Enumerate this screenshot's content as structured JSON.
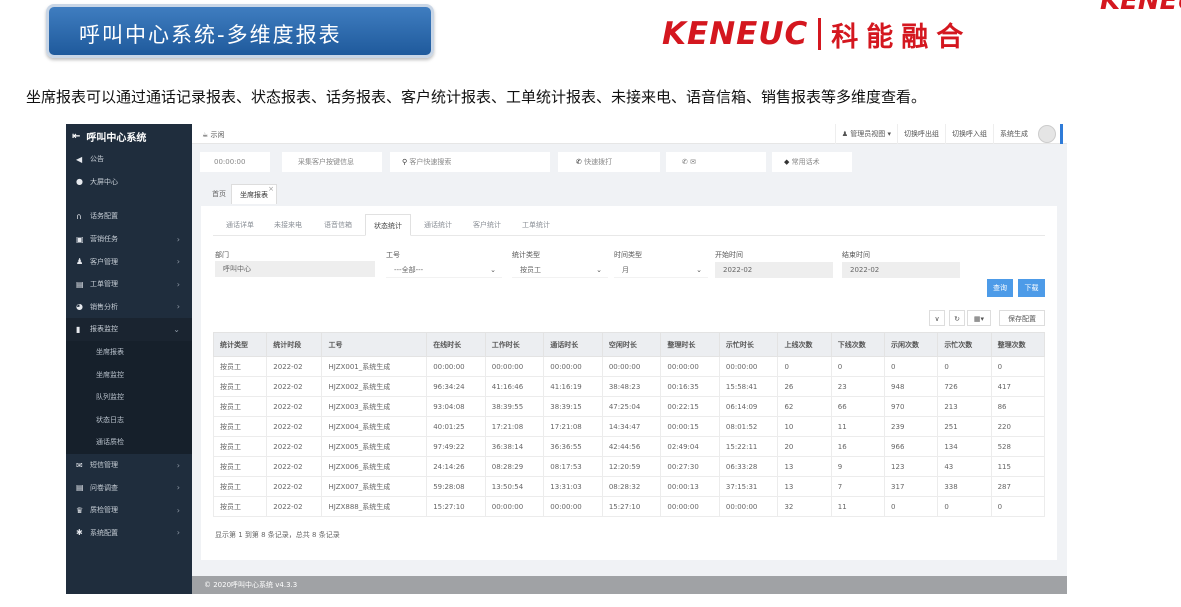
{
  "slide": {
    "banner_title": "呼叫中心系统-多维度报表",
    "logo_en": "KENEUC",
    "logo_cn": "科能融合",
    "logo_corner": "KENEUC",
    "description": "坐席报表可以通过通话记录报表、状态报表、话务报表、客户统计报表、工单统计报表、未接来电、语音信箱、销售报表等多维度查看。",
    "brand_color": "#d4171f"
  },
  "sidebar": {
    "title": "呼叫中心系统",
    "items": [
      {
        "label": "公告",
        "icon": "speaker-icon"
      },
      {
        "label": "大屏中心",
        "icon": "monitor-icon"
      },
      {
        "label": "话务配置",
        "icon": "headset-icon"
      },
      {
        "label": "营销任务",
        "icon": "briefcase-icon"
      },
      {
        "label": "客户管理",
        "icon": "user-icon"
      },
      {
        "label": "工单管理",
        "icon": "document-icon"
      },
      {
        "label": "销售分析",
        "icon": "pie-chart-icon"
      },
      {
        "label": "报表监控",
        "icon": "bar-chart-icon"
      }
    ],
    "report_sub": [
      "坐席报表",
      "坐席监控",
      "队列监控",
      "状态日志",
      "通话质检"
    ],
    "items_after": [
      {
        "label": "短信管理",
        "icon": "envelope-icon"
      },
      {
        "label": "问卷调查",
        "icon": "document-icon"
      },
      {
        "label": "质检管理",
        "icon": "trophy-icon"
      },
      {
        "label": "系统配置",
        "icon": "cog-icon"
      }
    ]
  },
  "topbar": {
    "status": "示闲",
    "admin_view": "管理员视图",
    "switch_out": "切换呼出组",
    "switch_in": "切换呼入组",
    "user": "系统生成"
  },
  "searchbar": {
    "timer": "00:00:00",
    "collect_info": "采集客户按键信息",
    "customer_search": "客户快速搜索",
    "quick_dial": "快速拨打",
    "common_scripts": "常用话术"
  },
  "page_tabs": {
    "home": "首页",
    "active": "坐席报表"
  },
  "subtabs": [
    "通话详单",
    "未接来电",
    "语音信箱",
    "状态统计",
    "通话统计",
    "客户统计",
    "工单统计"
  ],
  "filters": {
    "dept_label": "部门",
    "dept_value": "呼叫中心",
    "worknum_label": "工号",
    "worknum_value": "---全部---",
    "stat_type_label": "统计类型",
    "stat_type_value": "按员工",
    "time_type_label": "时间类型",
    "time_type_value": "月",
    "start_label": "开始时间",
    "start_value": "2022-02",
    "end_label": "结束时间",
    "end_value": "2022-02",
    "query_btn": "查询",
    "download_btn": "下载",
    "save_cfg": "保存配置"
  },
  "table": {
    "headers": [
      "统计类型",
      "统计时段",
      "工号",
      "在线时长",
      "工作时长",
      "通话时长",
      "空闲时长",
      "整理时长",
      "示忙时长",
      "上线次数",
      "下线次数",
      "示闲次数",
      "示忙次数",
      "整理次数"
    ],
    "rows": [
      [
        "按员工",
        "2022-02",
        "HJZX001_系统生成",
        "00:00:00",
        "00:00:00",
        "00:00:00",
        "00:00:00",
        "00:00:00",
        "00:00:00",
        "0",
        "0",
        "0",
        "0",
        "0"
      ],
      [
        "按员工",
        "2022-02",
        "HJZX002_系统生成",
        "96:34:24",
        "41:16:46",
        "41:16:19",
        "38:48:23",
        "00:16:35",
        "15:58:41",
        "26",
        "23",
        "948",
        "726",
        "417"
      ],
      [
        "按员工",
        "2022-02",
        "HJZX003_系统生成",
        "93:04:08",
        "38:39:55",
        "38:39:15",
        "47:25:04",
        "00:22:15",
        "06:14:09",
        "62",
        "66",
        "970",
        "213",
        "86"
      ],
      [
        "按员工",
        "2022-02",
        "HJZX004_系统生成",
        "40:01:25",
        "17:21:08",
        "17:21:08",
        "14:34:47",
        "00:00:15",
        "08:01:52",
        "10",
        "11",
        "239",
        "251",
        "220"
      ],
      [
        "按员工",
        "2022-02",
        "HJZX005_系统生成",
        "97:49:22",
        "36:38:14",
        "36:36:55",
        "42:44:56",
        "02:49:04",
        "15:22:11",
        "20",
        "16",
        "966",
        "134",
        "528"
      ],
      [
        "按员工",
        "2022-02",
        "HJZX006_系统生成",
        "24:14:26",
        "08:28:29",
        "08:17:53",
        "12:20:59",
        "00:27:30",
        "06:33:28",
        "13",
        "9",
        "123",
        "43",
        "115"
      ],
      [
        "按员工",
        "2022-02",
        "HJZX007_系统生成",
        "59:28:08",
        "13:50:54",
        "13:31:03",
        "08:28:32",
        "00:00:13",
        "37:15:31",
        "13",
        "7",
        "317",
        "338",
        "287"
      ],
      [
        "按员工",
        "2022-02",
        "HJZX888_系统生成",
        "15:27:10",
        "00:00:00",
        "00:00:00",
        "15:27:10",
        "00:00:00",
        "00:00:00",
        "32",
        "11",
        "0",
        "0",
        "0"
      ]
    ]
  },
  "pager": "显示第 1 到第 8 条记录，总共 8 条记录",
  "footer": "© 2020呼叫中心系统   v4.3.3"
}
